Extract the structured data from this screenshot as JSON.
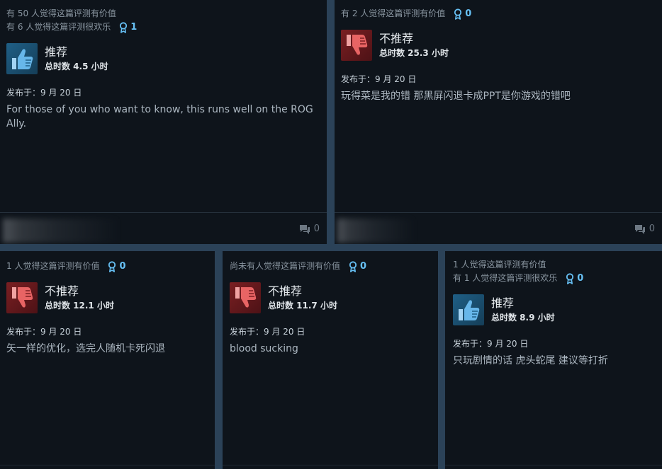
{
  "colors": {
    "background": "#2b4258",
    "card": "#0e141b",
    "accent": "#67c1f5",
    "recommended": "#1f5f86",
    "not_recommended": "#7a1f22"
  },
  "reviews": [
    {
      "helpful_text": "有 50 人觉得这篇评测有价值",
      "funny_text": "有 6 人觉得这篇评测很欢乐",
      "award_count": "1",
      "verdict": "推荐",
      "verdict_icon": "thumbs-up-icon",
      "hours": "总时数 4.5 小时",
      "posted": "发布于：9 月 20 日",
      "content": "For those of you who want to know, this runs well on the ROG Ally.",
      "comment_count": "0"
    },
    {
      "helpful_text": "有 2 人觉得这篇评测有价值",
      "award_count": "0",
      "verdict": "不推荐",
      "verdict_icon": "thumbs-down-icon",
      "hours": "总时数 25.3 小时",
      "posted": "发布于：9 月 20 日",
      "content": "玩得菜是我的错 那黑屏闪退卡成PPT是你游戏的错吧",
      "comment_count": "0"
    },
    {
      "helpful_text": "1 人觉得这篇评测有价值",
      "award_count": "0",
      "verdict": "不推荐",
      "verdict_icon": "thumbs-down-icon",
      "hours": "总时数 12.1 小时",
      "posted": "发布于：9 月 20 日",
      "content": "矢一样的优化，选完人随机卡死闪退"
    },
    {
      "helpful_text": "尚未有人觉得这篇评测有价值",
      "award_count": "0",
      "verdict": "不推荐",
      "verdict_icon": "thumbs-down-icon",
      "hours": "总时数 11.7 小时",
      "posted": "发布于：9 月 20 日",
      "content": "blood sucking"
    },
    {
      "helpful_text": "1 人觉得这篇评测有价值",
      "funny_text": "有 1 人觉得这篇评测很欢乐",
      "award_count": "0",
      "verdict": "推荐",
      "verdict_icon": "thumbs-up-icon",
      "hours": "总时数 8.9 小时",
      "posted": "发布于：9 月 20 日",
      "content": "只玩剧情的话 虎头蛇尾 建议等打折"
    }
  ]
}
